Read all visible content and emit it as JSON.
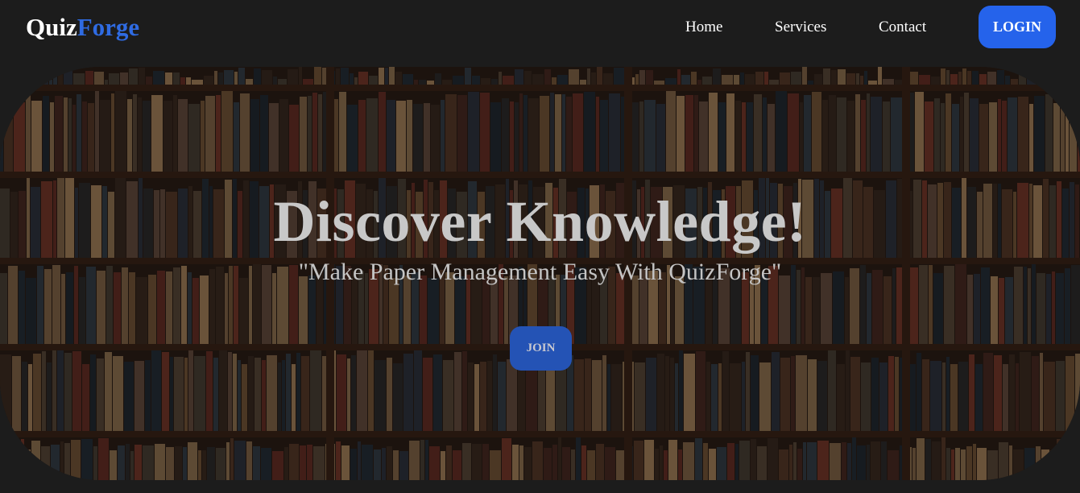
{
  "brand": {
    "name_primary": "Quiz",
    "name_accent": "Forge"
  },
  "nav": {
    "links": [
      {
        "label": "Home"
      },
      {
        "label": "Services"
      },
      {
        "label": "Contact"
      }
    ],
    "login_label": "LOGIN"
  },
  "hero": {
    "title": "Discover Knowledge!",
    "subtitle": "\"Make Paper Management Easy With QuizForge\"",
    "join_label": "JOIN",
    "background_image": "bookshelf-library-photo"
  },
  "colors": {
    "background": "#1c1c1c",
    "accent": "#2f6be2",
    "login_button": "#2563eb",
    "join_button": "#2453b5",
    "hero_text": "#c8c8c8"
  }
}
